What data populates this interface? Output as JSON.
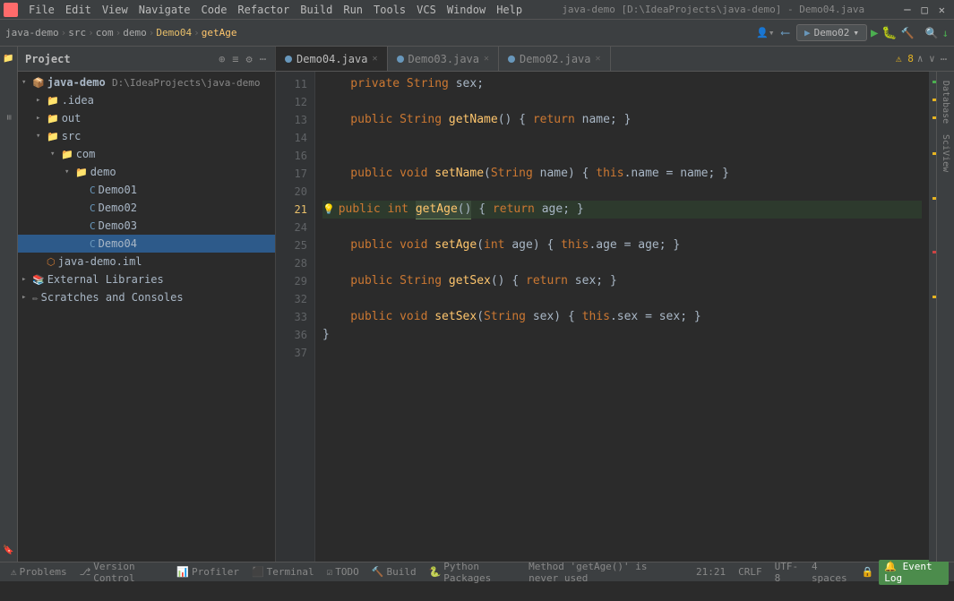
{
  "window": {
    "title": "java-demo [D:\\IdeaProjects\\java-demo] - Demo04.java"
  },
  "menubar": {
    "items": [
      "File",
      "Edit",
      "View",
      "Navigate",
      "Code",
      "Refactor",
      "Build",
      "Run",
      "Tools",
      "VCS",
      "Window",
      "Help"
    ],
    "title": "java-demo [D:\\IdeaProjects\\java-demo] - Demo04.java"
  },
  "breadcrumb": {
    "items": [
      "java-demo",
      "src",
      "com",
      "demo",
      "Demo04",
      "getAge"
    ]
  },
  "run_config": {
    "label": "Demo02",
    "dropdown": "▾"
  },
  "toolbar": {
    "search_icon": "🔍",
    "update_icon": "↓"
  },
  "project_panel": {
    "title": "Project",
    "root": "java-demo",
    "root_path": "D:\\IdeaProjects\\java-demo",
    "items": [
      {
        "label": ".idea",
        "type": "folder",
        "indent": 1
      },
      {
        "label": "out",
        "type": "folder",
        "indent": 1,
        "expanded": false
      },
      {
        "label": "src",
        "type": "src",
        "indent": 1,
        "expanded": true
      },
      {
        "label": "com",
        "type": "folder",
        "indent": 2,
        "expanded": true
      },
      {
        "label": "demo",
        "type": "folder",
        "indent": 3,
        "expanded": true
      },
      {
        "label": "Demo01",
        "type": "java",
        "indent": 4
      },
      {
        "label": "Demo02",
        "type": "java",
        "indent": 4
      },
      {
        "label": "Demo03",
        "type": "java",
        "indent": 4
      },
      {
        "label": "Demo04",
        "type": "java",
        "indent": 4,
        "selected": true
      },
      {
        "label": "java-demo.iml",
        "type": "module",
        "indent": 1
      },
      {
        "label": "External Libraries",
        "type": "lib",
        "indent": 0
      },
      {
        "label": "Scratches and Consoles",
        "type": "scratches",
        "indent": 0
      }
    ]
  },
  "tabs": [
    {
      "label": "Demo04.java",
      "active": true
    },
    {
      "label": "Demo03.java",
      "active": false
    },
    {
      "label": "Demo02.java",
      "active": false
    }
  ],
  "warnings": {
    "count": "⚠ 8",
    "arrows": "∧ ∨"
  },
  "code": {
    "lines": [
      {
        "num": 11,
        "content": "    private String sex;"
      },
      {
        "num": 12,
        "content": ""
      },
      {
        "num": 13,
        "content": "    public String getName() { return name; }"
      },
      {
        "num": 14,
        "content": ""
      },
      {
        "num": 16,
        "content": ""
      },
      {
        "num": 17,
        "content": "    public void setName(String name) { this.name = name; }"
      },
      {
        "num": 20,
        "content": ""
      },
      {
        "num": 21,
        "content": "    public int getAge() { return age; }",
        "hint": true,
        "highlight": true
      },
      {
        "num": 24,
        "content": ""
      },
      {
        "num": 25,
        "content": "    public void setAge(int age) { this.age = age; }"
      },
      {
        "num": 28,
        "content": ""
      },
      {
        "num": 29,
        "content": "    public String getSex() { return sex; }"
      },
      {
        "num": 32,
        "content": ""
      },
      {
        "num": 33,
        "content": "    public void setSex(String sex) { this.sex = sex; }"
      },
      {
        "num": 36,
        "content": "}"
      },
      {
        "num": 37,
        "content": ""
      }
    ]
  },
  "right_tabs": [
    "Database",
    "SciView"
  ],
  "status_bar": {
    "problems": "Problems",
    "version_control": "Version Control",
    "profiler": "Profiler",
    "terminal": "Terminal",
    "todo": "TODO",
    "build": "Build",
    "python_packages": "Python Packages",
    "position": "21:21",
    "line_ending": "CRLF",
    "encoding": "UTF-8",
    "indent": "4 spaces",
    "event_log": "Event Log"
  },
  "bottom_status": {
    "message": "Method 'getAge()' is never used"
  }
}
